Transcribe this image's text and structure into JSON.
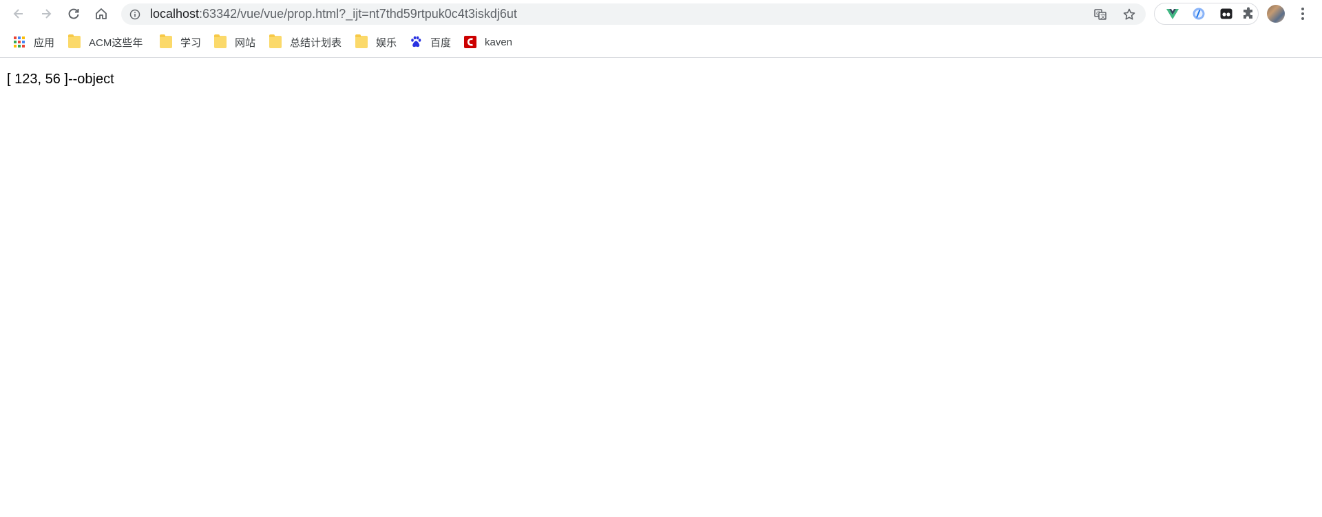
{
  "browser": {
    "url_host": "localhost",
    "url_rest": ":63342/vue/vue/prop.html?_ijt=nt7thd59rtpuk0c4t3iskdj6ut",
    "icons": {
      "back": "arrow-left-icon",
      "forward": "arrow-right-icon",
      "reload": "reload-icon",
      "home": "home-icon",
      "site_info": "info-icon",
      "translate": "translate-icon",
      "bookmark": "star-icon",
      "menu": "kebab-menu-icon"
    },
    "extensions": [
      "vue-devtools-icon",
      "extension-blue-icon",
      "extension-dark-icon",
      "puzzle-icon"
    ],
    "bookmarks": [
      {
        "label": "应用",
        "icon": "apps-grid-icon"
      },
      {
        "label": "ACM这些年",
        "icon": "folder-icon"
      },
      {
        "label": "学习",
        "icon": "folder-icon"
      },
      {
        "label": "网站",
        "icon": "folder-icon"
      },
      {
        "label": "总结计划表",
        "icon": "folder-icon"
      },
      {
        "label": "娱乐",
        "icon": "folder-icon"
      },
      {
        "label": "百度",
        "icon": "baidu-paw-icon"
      },
      {
        "label": "kaven",
        "icon": "kaven-logo-icon"
      }
    ]
  },
  "page": {
    "output_text": "[ 123, 56 ]--object"
  },
  "colors": {
    "omnibox_bg": "#f1f3f4",
    "folder": "#fbd96a",
    "vue_green": "#41b883",
    "baidu_blue": "#2932e1",
    "kaven_red": "#cc0000"
  }
}
